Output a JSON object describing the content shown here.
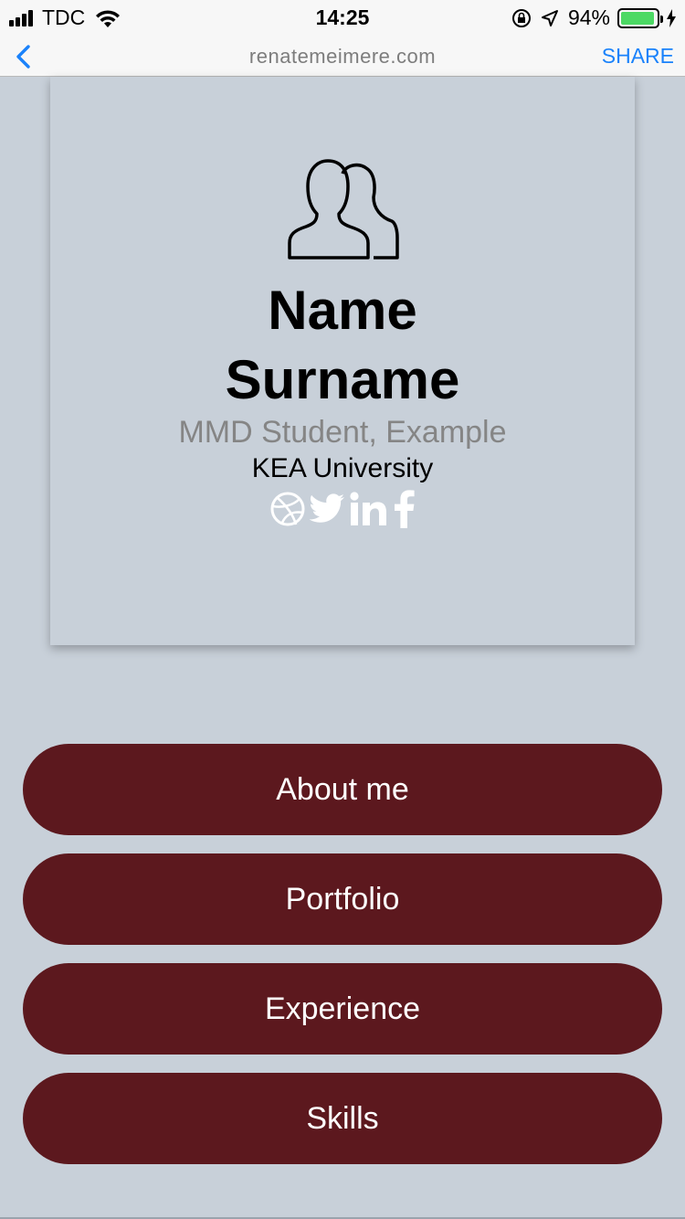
{
  "status_bar": {
    "carrier": "TDC",
    "time": "14:25",
    "battery_percent": "94%",
    "battery_level": 0.94
  },
  "browser": {
    "url": "renatemeimere.com",
    "share_label": "SHARE",
    "accent_color": "#1a82fb"
  },
  "profile": {
    "name_line1": "Name",
    "name_line2": "Surname",
    "role": "MMD Student, Example",
    "university": "KEA University",
    "social_icons": [
      "dribbble-icon",
      "twitter-icon",
      "linkedin-icon",
      "facebook-icon"
    ]
  },
  "nav": {
    "about_label": "About me",
    "portfolio_label": "Portfolio",
    "experience_label": "Experience",
    "skills_label": "Skills",
    "button_color": "#5c181e"
  },
  "page_background": "#c8d0d9"
}
